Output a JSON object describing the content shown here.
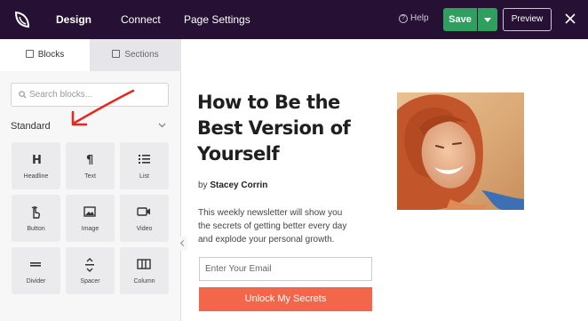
{
  "topbar": {
    "tabs": [
      {
        "label": "Design",
        "active": true
      },
      {
        "label": "Connect",
        "active": false
      },
      {
        "label": "Page Settings",
        "active": false
      }
    ],
    "help_label": "Help",
    "save_label": "Save",
    "preview_label": "Preview",
    "colors": {
      "background": "#261134",
      "save": "#2f9f5f"
    }
  },
  "sidebar": {
    "tabs": [
      {
        "label": "Blocks",
        "icon": "blocks-icon",
        "active": true
      },
      {
        "label": "Sections",
        "icon": "sections-icon",
        "active": false
      }
    ],
    "search_placeholder": "Search blocks...",
    "section_label": "Standard",
    "blocks": [
      {
        "label": "Headline",
        "icon": "heading-icon"
      },
      {
        "label": "Text",
        "icon": "paragraph-icon"
      },
      {
        "label": "List",
        "icon": "list-icon"
      },
      {
        "label": "Button",
        "icon": "pointer-hand-icon"
      },
      {
        "label": "Image",
        "icon": "image-icon"
      },
      {
        "label": "Video",
        "icon": "video-camera-icon"
      },
      {
        "label": "Divider",
        "icon": "divider-icon"
      },
      {
        "label": "Spacer",
        "icon": "spacer-icon"
      },
      {
        "label": "Column",
        "icon": "columns-icon"
      }
    ]
  },
  "page": {
    "headline": "How to Be the Best Version of Yourself",
    "by_prefix": "by",
    "author": "Stacey Corrin",
    "description": "This weekly newsletter will show you the secrets of getting better every day and explode your personal growth.",
    "email_placeholder": "Enter Your Email",
    "cta_label": "Unlock My Secrets",
    "accent_color": "#f4664a"
  }
}
